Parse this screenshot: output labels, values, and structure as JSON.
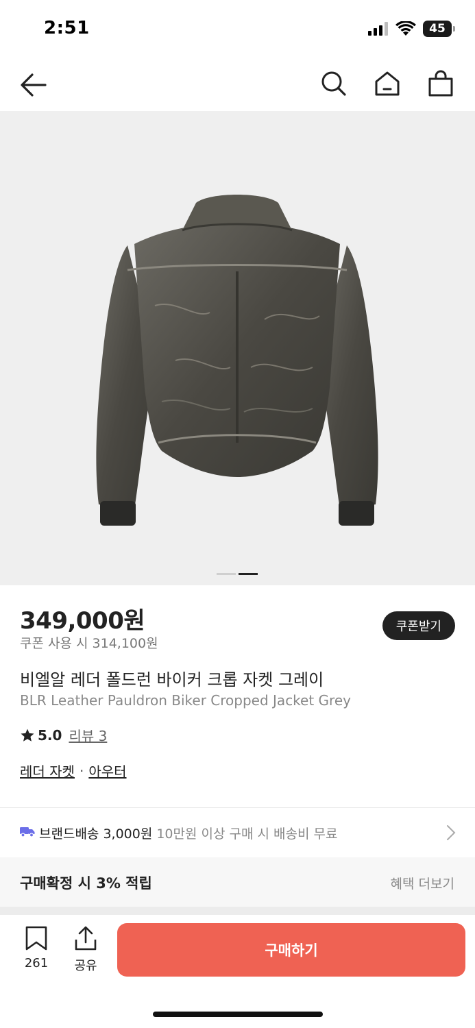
{
  "status_bar": {
    "time": "2:51",
    "battery": "45"
  },
  "nav": {
    "back_icon": "arrow-left-icon",
    "search_icon": "search-icon",
    "home_icon": "home-icon",
    "cart_icon": "shopping-bag-icon"
  },
  "gallery": {
    "image": "biker-jacket-back-view",
    "page_count": 2,
    "current_page": 2
  },
  "product": {
    "price": "349,000원",
    "coupon_price": "쿠폰 사용 시 314,100원",
    "coupon_button": "쿠폰받기",
    "name_ko": "비엘알 레더 폴드런 바이커 크롭 자켓 그레이",
    "name_en": "BLR Leather Pauldron Biker Cropped Jacket Grey",
    "rating": "5.0",
    "reviews": "리뷰 3",
    "categories": [
      "레더 자켓",
      "아우터"
    ],
    "category_separator": "·"
  },
  "shipping": {
    "label": "브랜드배송 3,000원",
    "note": "10만원 이상 구매 시 배송비 무료",
    "accent_color": "#6b6ee8"
  },
  "benefit": {
    "label": "구매확정 시 3% 적립",
    "more": "혜택 더보기"
  },
  "bottom": {
    "bookmark_count": "261",
    "share_label": "공유",
    "buy_label": "구매하기",
    "buy_color": "#ef6253"
  }
}
